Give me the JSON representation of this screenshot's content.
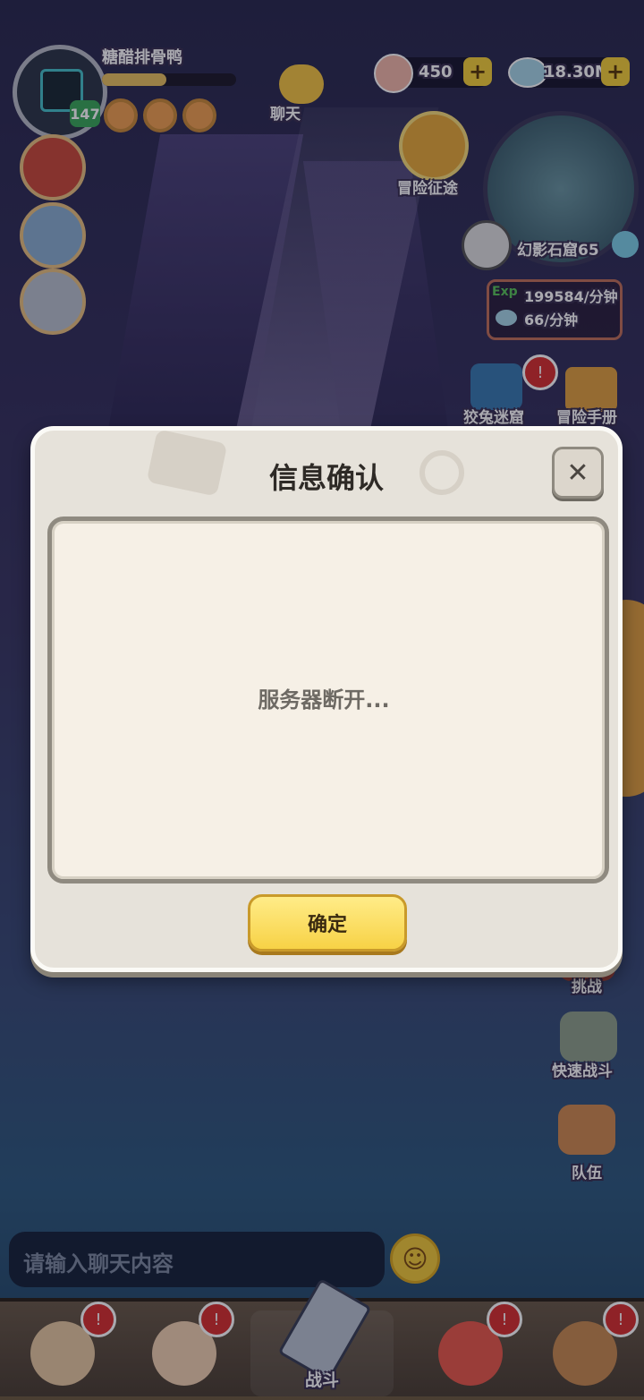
{
  "player": {
    "name": "糖醋排骨鸭",
    "level": "147"
  },
  "chat": {
    "label": "聊天",
    "input_placeholder": "请输入聊天内容"
  },
  "currency": {
    "shells": "450",
    "gems": "18.30M"
  },
  "adventure": {
    "label": "冒险征途"
  },
  "map": {
    "location": "幻影石窟65"
  },
  "rates": {
    "exp_tag": "Exp",
    "exp_rate": "199584/分钟",
    "gem_rate": "66/分钟"
  },
  "side_buttons": {
    "maze": "狡兔迷窟",
    "handbook": "冒险手册",
    "challenge": "挑战",
    "quick_battle": "快速战斗",
    "team": "队伍"
  },
  "dialog": {
    "title": "信息确认",
    "message": "服务器断开...",
    "confirm_label": "确定",
    "close_glyph": "✕"
  },
  "bottom_nav": {
    "battle": "战斗"
  },
  "colors": {
    "accent_yellow": "#f7d246",
    "alert_red": "#d8312e",
    "panel_bg": "#f6f0e6"
  }
}
